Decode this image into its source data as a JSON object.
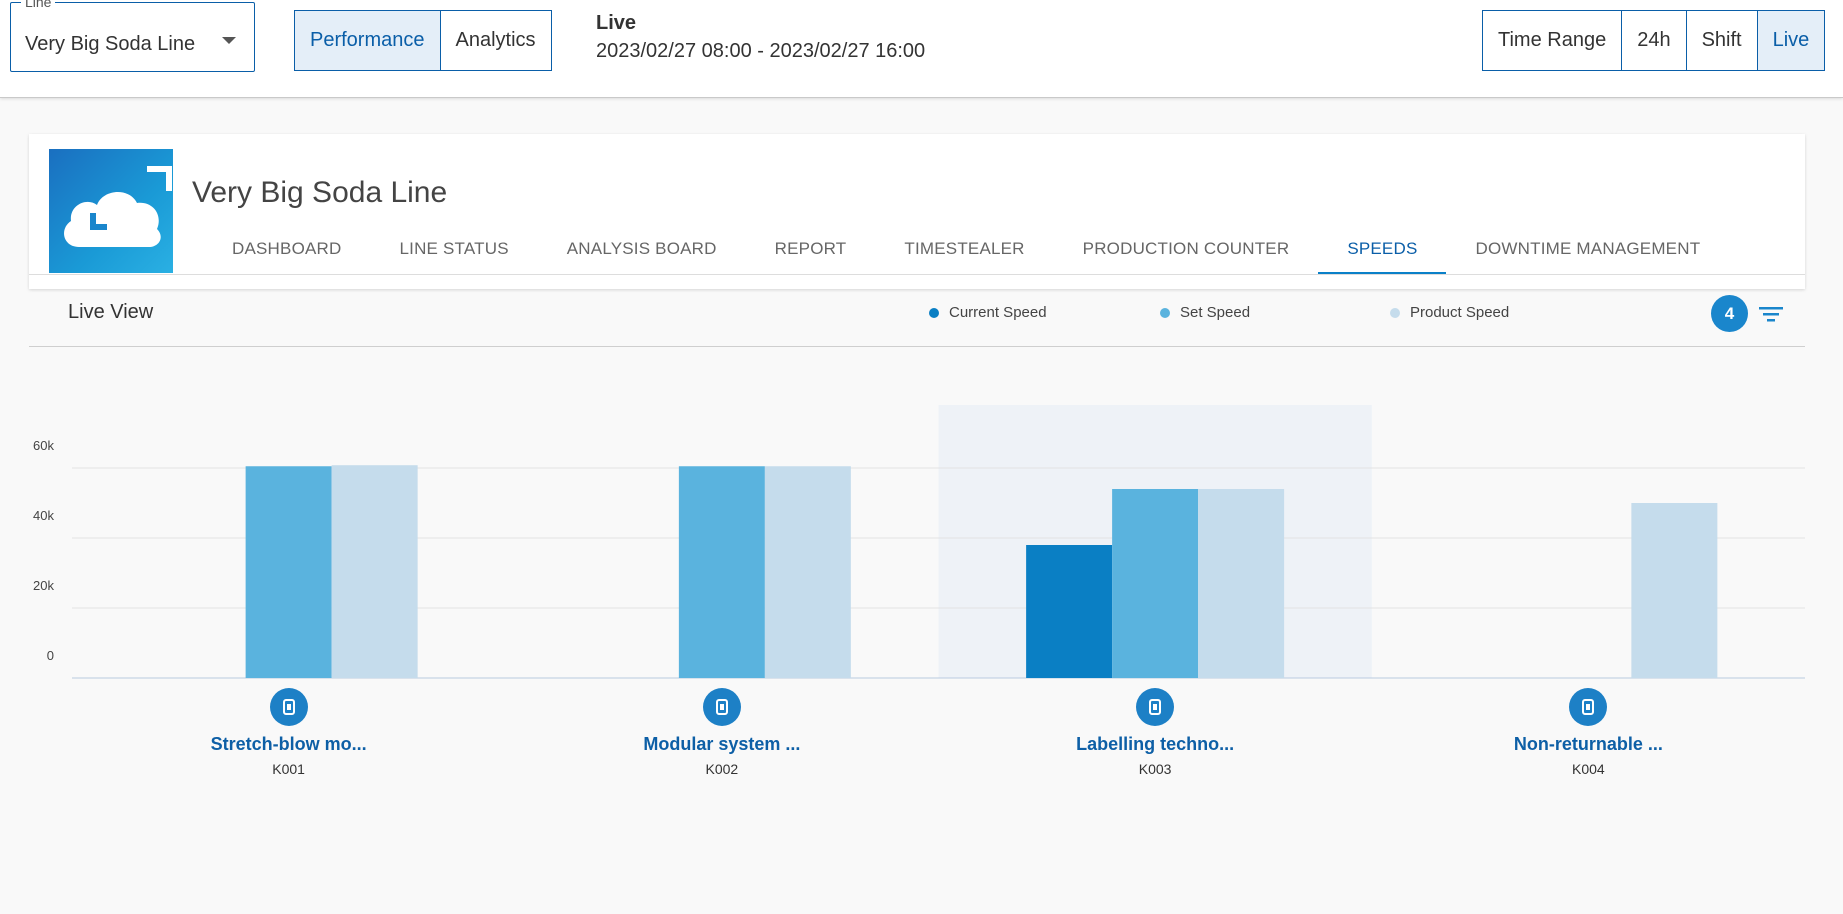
{
  "topbar": {
    "line_legend": "Line",
    "line_value": "Very Big Soda Line",
    "views": [
      "Performance",
      "Analytics"
    ],
    "active_view": "Performance",
    "live_title": "Live",
    "live_range": "2023/02/27 08:00 - 2023/02/27 16:00",
    "time_options": [
      "Time Range",
      "24h",
      "Shift",
      "Live"
    ],
    "active_time": "Live"
  },
  "card": {
    "title": "Very Big Soda Line",
    "tabs": [
      "DASHBOARD",
      "LINE STATUS",
      "ANALYSIS BOARD",
      "REPORT",
      "TIMESTEALER",
      "PRODUCTION COUNTER",
      "SPEEDS",
      "DOWNTIME MANAGEMENT"
    ],
    "active_tab": "SPEEDS"
  },
  "liveview": {
    "label": "Live View",
    "filter_count": "4"
  },
  "colors": {
    "current": "#0a7fc4",
    "set": "#5ab3de",
    "product": "#c5dcec",
    "highlight": "#eef2f7",
    "accent": "#0a5ea8"
  },
  "chart_data": {
    "type": "bar",
    "categories": [
      "K001",
      "K002",
      "K003",
      "K004"
    ],
    "category_names": [
      "Stretch-blow mo...",
      "Modular system ...",
      "Labelling techno...",
      "Non-returnable ..."
    ],
    "icons": [
      "blow-molder-icon",
      "modular-system-icon",
      "labeller-icon",
      "bottle-icon"
    ],
    "series": [
      {
        "name": "Current Speed",
        "values": [
          0,
          0,
          38000,
          0
        ]
      },
      {
        "name": "Set Speed",
        "values": [
          60500,
          60500,
          54000,
          0
        ]
      },
      {
        "name": "Product Speed",
        "values": [
          60800,
          60500,
          54000,
          50000
        ]
      }
    ],
    "yticks": [
      "0",
      "20k",
      "40k",
      "60k"
    ],
    "ylim": [
      0,
      60000
    ],
    "highlighted_category": "K003",
    "grid": true
  }
}
